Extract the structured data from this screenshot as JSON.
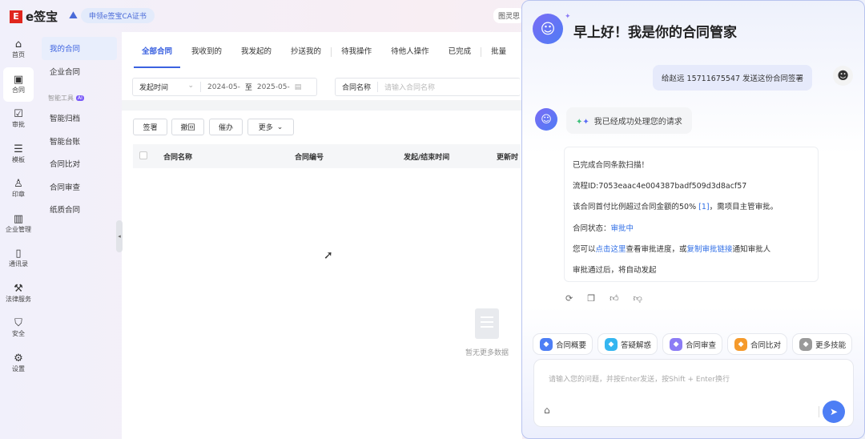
{
  "app": {
    "logo": "e签宝",
    "logo_mark": "E",
    "ca_label": "申领e签宝CA证书",
    "user": "图灵思"
  },
  "nav": [
    {
      "icon": "⌂",
      "label": "首页"
    },
    {
      "icon": "▣",
      "label": "合同"
    },
    {
      "icon": "☑",
      "label": "审批"
    },
    {
      "icon": "☰",
      "label": "模板"
    },
    {
      "icon": "♙",
      "label": "印章"
    },
    {
      "icon": "▥",
      "label": "企业管理"
    },
    {
      "icon": "▯",
      "label": "通讯录"
    },
    {
      "icon": "⚒",
      "label": "法律服务"
    },
    {
      "icon": "⛉",
      "label": "安全"
    },
    {
      "icon": "⚙",
      "label": "设置"
    }
  ],
  "side": {
    "my": "我的合同",
    "corp": "企业合同",
    "group": "智能工具",
    "ai": "AI",
    "items": [
      "智能归档",
      "智能台账",
      "合同比对",
      "合同审查",
      "纸质合同"
    ]
  },
  "tabs": [
    "全部合同",
    "我收到的",
    "我发起的",
    "抄送我的",
    "待我操作",
    "待他人操作",
    "已完成",
    "批量"
  ],
  "filter": {
    "time_label": "发起时间",
    "start": "2024-05-",
    "to": "至",
    "end": "2025-05-",
    "name_label": "合同名称",
    "name_placeholder": "请输入合同名称"
  },
  "buttons": [
    "签署",
    "撤回",
    "催办",
    "更多"
  ],
  "table": {
    "headers": [
      "合同名称",
      "合同编号",
      "发起/结束时间",
      "更新时"
    ]
  },
  "empty": "暂无更多数据",
  "chat": {
    "greeting": "早上好！我是你的合同管家",
    "user_msg": "给赵远 15711675547 发送这份合同签署",
    "ok": "我已经成功处理您的请求",
    "lines": {
      "l1": "已完成合同条款扫描！",
      "l2": "流程ID:7053eaac4e004387badf509d3d8acf57",
      "l3a": "该合同首付比例超过合同金额的50%",
      "l3ref": "[1]",
      "l3b": "，需项目主管审批。",
      "l4a": "合同状态：",
      "l4b": "审批中",
      "l5a": "您可以",
      "l5b": "点击这里",
      "l5c": "查看审批进度，或",
      "l5d": "复制审批链接",
      "l5e": "通知审批人",
      "l6": "审批通过后，将自动发起"
    },
    "skills": [
      {
        "label": "合同概要",
        "color": "#4d7ef5"
      },
      {
        "label": "答疑解惑",
        "color": "#35b6f0"
      },
      {
        "label": "合同审查",
        "color": "#8c7cf5"
      },
      {
        "label": "合同比对",
        "color": "#f59a2b"
      },
      {
        "label": "更多技能",
        "color": "#9a9a9a"
      }
    ],
    "input_placeholder": "请输入您的问题，并按Enter发送，按Shift + Enter换行"
  }
}
